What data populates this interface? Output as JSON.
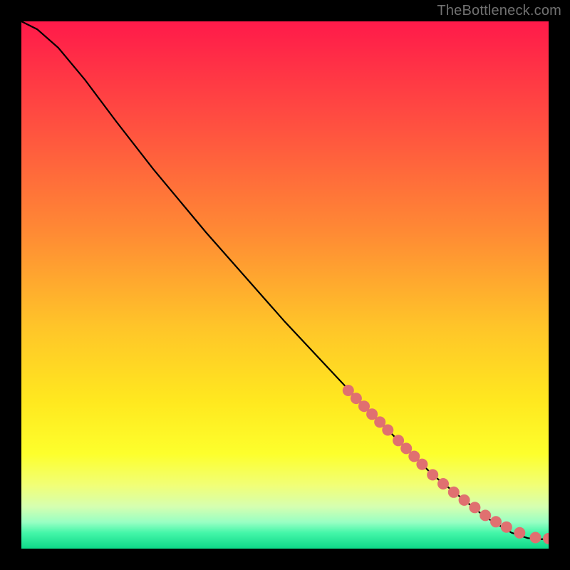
{
  "attribution": "TheBottleneck.com",
  "colors": {
    "marker": "#e07070",
    "curve": "#000000",
    "frame": "#000000",
    "attribution_text": "#717171"
  },
  "chart_data": {
    "type": "line",
    "title": "",
    "xlabel": "",
    "ylabel": "",
    "xlim": [
      0,
      100
    ],
    "ylim": [
      0,
      100
    ],
    "grid": false,
    "legend": false,
    "background_gradient": {
      "stops": [
        {
          "offset": 0,
          "color": "#ff1a4a"
        },
        {
          "offset": 20,
          "color": "#ff5140"
        },
        {
          "offset": 40,
          "color": "#ff8a34"
        },
        {
          "offset": 58,
          "color": "#ffc529"
        },
        {
          "offset": 72,
          "color": "#ffe81f"
        },
        {
          "offset": 82,
          "color": "#fdff2c"
        },
        {
          "offset": 88,
          "color": "#f1ff77"
        },
        {
          "offset": 92,
          "color": "#d6ffb0"
        },
        {
          "offset": 95,
          "color": "#98ffc3"
        },
        {
          "offset": 97,
          "color": "#44f6a9"
        },
        {
          "offset": 100,
          "color": "#0ed989"
        }
      ]
    },
    "series": [
      {
        "name": "curve",
        "kind": "line",
        "x": [
          0,
          3,
          7,
          12,
          18,
          25,
          35,
          50,
          65,
          78,
          88,
          93,
          96,
          98,
          100
        ],
        "y": [
          100,
          98.5,
          95,
          89,
          81,
          72,
          60,
          43,
          27,
          14,
          6,
          3,
          2,
          1.8,
          1.8
        ]
      },
      {
        "name": "markers",
        "kind": "scatter",
        "x": [
          62,
          63.5,
          65,
          66.5,
          68,
          69.5,
          71.5,
          73,
          74.5,
          76,
          78,
          80,
          82,
          84,
          86,
          88,
          90,
          92,
          94.5,
          97.5,
          100
        ],
        "y": [
          30,
          28.5,
          27,
          25.5,
          24,
          22.5,
          20.5,
          19,
          17.5,
          16,
          14,
          12.3,
          10.7,
          9.2,
          7.8,
          6.3,
          5.1,
          4.1,
          3.0,
          2.1,
          1.9
        ]
      }
    ]
  }
}
